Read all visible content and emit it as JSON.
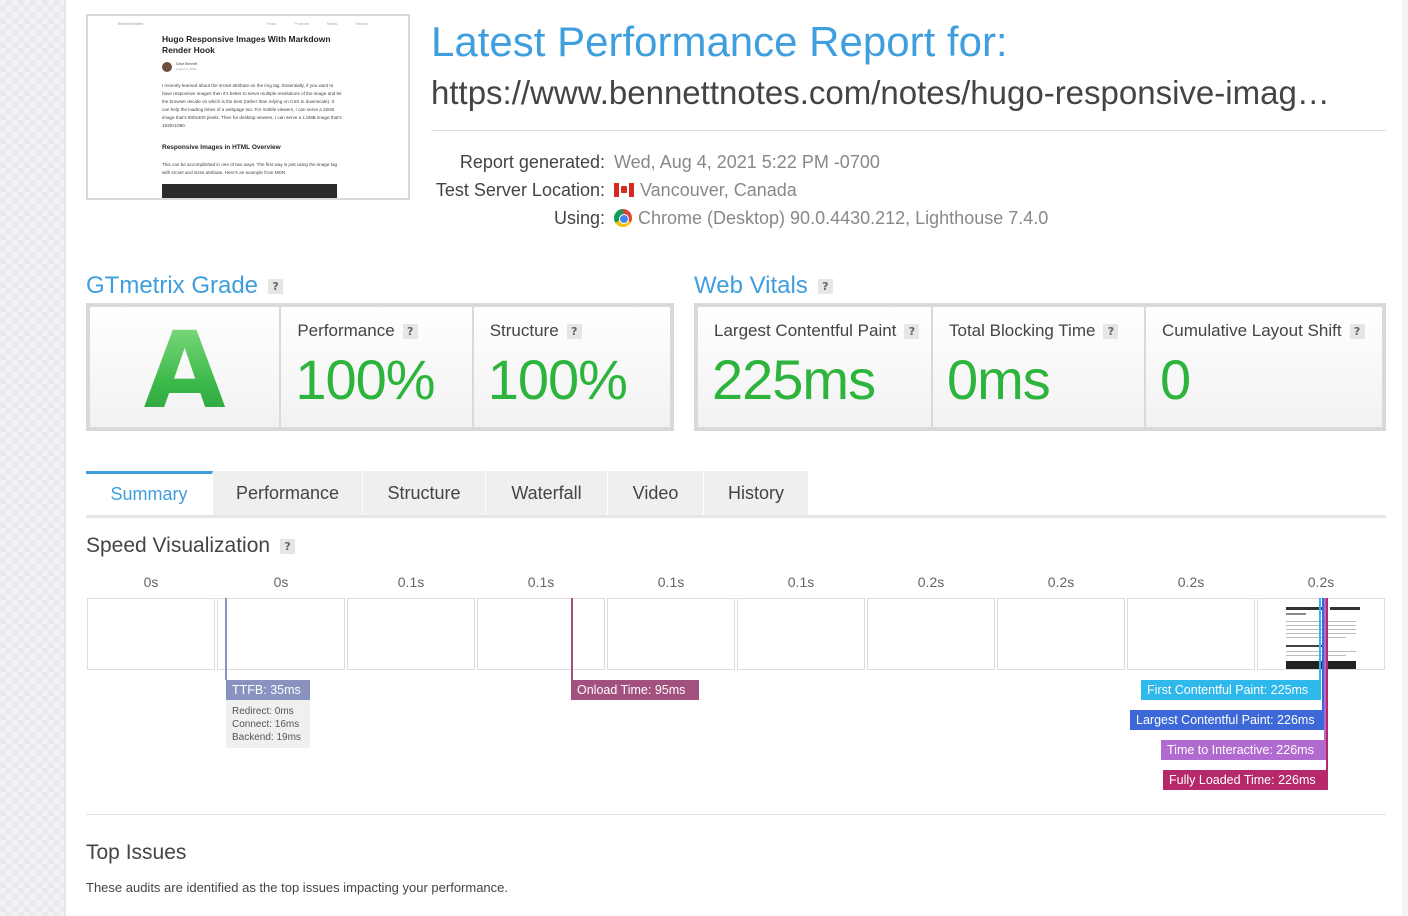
{
  "thumbnail": {
    "site_name": "Bennett Notes",
    "nav_links": [
      "Posts",
      "Projects",
      "Notes",
      "Search"
    ],
    "title": "Hugo Responsive Images With Markdown Render Hook",
    "author": "Dave Bennett",
    "date": "August 4, 2021",
    "paragraph": "I recently learned about the srcset attribute on the img tag. Essentially, if you want to have responsive images then it's better to serve multiple resolutions of the image and let the browser decide on which is the best (rather than relying on CSS to downscale). It can help the loading times of a webpage too. For mobile viewers, I can serve a 22KB image that's 800x400 pixels. Then for desktop viewers, I can serve a 1.5MB image that's 1920x1080.",
    "subheading": "Responsive Images in HTML Overview",
    "paragraph2": "This can be accomplished in one of two ways. The first way is just using the image tag with srcset and sizes attribute. Here's an example from MDN"
  },
  "header": {
    "title": "Latest Performance Report for:",
    "url": "https://www.bennettnotes.com/notes/hugo-responsive-imag…"
  },
  "meta": {
    "generated_label": "Report generated:",
    "generated_value": "Wed, Aug 4, 2021 5:22 PM -0700",
    "location_label": "Test Server Location:",
    "location_value": "Vancouver, Canada",
    "using_label": "Using:",
    "using_value": "Chrome (Desktop) 90.0.4430.212, Lighthouse 7.4.0"
  },
  "gtmetrix": {
    "heading": "GTmetrix Grade",
    "help": "?",
    "grade": "A",
    "performance_label": "Performance",
    "performance_value": "100%",
    "structure_label": "Structure",
    "structure_value": "100%"
  },
  "web_vitals": {
    "heading": "Web Vitals",
    "help": "?",
    "lcp_label": "Largest Contentful Paint",
    "lcp_value": "225ms",
    "tbt_label": "Total Blocking Time",
    "tbt_value": "0ms",
    "cls_label": "Cumulative Layout Shift",
    "cls_value": "0"
  },
  "tabs": [
    "Summary",
    "Performance",
    "Structure",
    "Waterfall",
    "Video",
    "History"
  ],
  "active_tab": "Summary",
  "speed_visualization": {
    "title": "Speed Visualization",
    "help": "?",
    "ticks": [
      "0s",
      "0s",
      "0.1s",
      "0.1s",
      "0.1s",
      "0.1s",
      "0.2s",
      "0.2s",
      "0.2s",
      "0.2s"
    ],
    "ttfb": "TTFB: 35ms",
    "ttfb_details": [
      "Redirect: 0ms",
      "Connect: 16ms",
      "Backend: 19ms"
    ],
    "onload": "Onload Time: 95ms",
    "fcp": "First Contentful Paint: 225ms",
    "lcp": "Largest Contentful Paint: 226ms",
    "tti": "Time to Interactive: 226ms",
    "fully_loaded": "Fully Loaded Time: 226ms"
  },
  "colors": {
    "accent": "#3f9ede",
    "grade_green": "#2db43c",
    "ttfb": "#8a92c0",
    "onload": "#a2507d",
    "fcp": "#2eb8ec",
    "lcp": "#3d68d8",
    "tti": "#b06ad0",
    "fully_loaded": "#b5296a"
  },
  "top_issues": {
    "title": "Top Issues",
    "description": "These audits are identified as the top issues impacting your performance."
  }
}
